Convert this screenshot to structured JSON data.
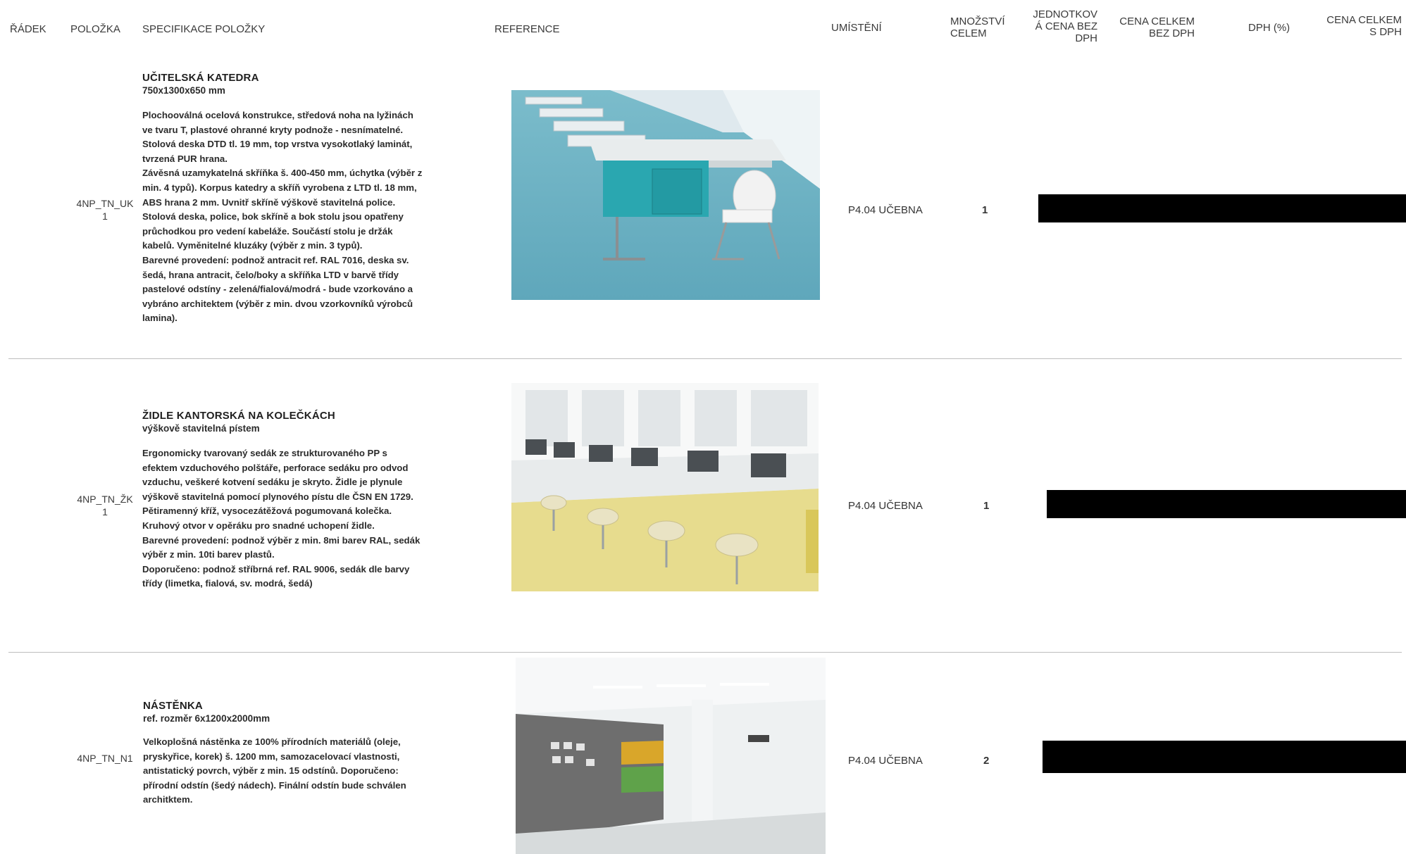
{
  "headers": {
    "radek": "ŘÁDEK",
    "polozka": "POLOŽKA",
    "specifikace": "SPECIFIKACE POLOŽKY",
    "reference": "REFERENCE",
    "umisteni": "UMÍSTĚNÍ",
    "mnozstvi_line1": "MNOŽSTVÍ",
    "mnozstvi_line2": "CELEM",
    "jednotkova_line1": "JEDNOTKOV",
    "jednotkova_line2": "Á CENA BEZ",
    "jednotkova_line3": "DPH",
    "cena_bez_line1": "CENA CELKEM",
    "cena_bez_line2": "BEZ DPH",
    "dph": "DPH (%)",
    "cena_s_line1": "CENA CELKEM",
    "cena_s_line2": "S DPH"
  },
  "rows": [
    {
      "code_line1": "4NP_TN_UK",
      "code_line2": "1",
      "title": "UČITELSKÁ KATEDRA",
      "subtitle": "750x1300x650 mm",
      "description": "Plochooválná ocelová konstrukce, středová noha na lyžinách\nve tvaru T, plastové ohranné kryty podnože - nesnímatelné.\nStolová deska DTD tl. 19 mm, top vrstva vysokotlaký laminát,\ntvrzená PUR hrana.\nZávěsná uzamykatelná skříňka š. 400-450 mm, úchytka (výběr z\nmin. 4 typů). Korpus katedry a skříň vyrobena z LTD tl. 18 mm,\nABS hrana 2 mm. Uvnitř skříně výškově stavitelná police.\nStolová deska, police, bok skříně a bok stolu jsou opatřeny\nprůchodkou pro vedení kabeláže. Součástí stolu je držák\nkabelů. Vyměnitelné kluzáky (výběr z min. 3 typů).\nBarevné provedení: podnož antracit ref. RAL 7016, deska sv.\nšedá, hrana antracit, čelo/boky a skříňka LTD v barvě třídy\npastelové odstíny - zelená/fialová/modrá - bude vzorkováno a\nvybráno architektem (výběr z min. dvou vzorkovníků výrobců\nlamina).",
      "location": "P4.04 UČEBNA",
      "quantity": "1"
    },
    {
      "code_line1": "4NP_TN_ŽK",
      "code_line2": "1",
      "title": "ŽIDLE KANTORSKÁ NA KOLEČKÁCH",
      "subtitle": "výškově stavitelná pístem",
      "description": "Ergonomicky tvarovaný sedák ze strukturovaného PP s\nefektem vzduchového polštáře, perforace sedáku pro odvod\nvzduchu, veškeré kotvení sedáku je skryto. Židle je plynule\nvýškově stavitelná pomocí plynového pístu dle ČSN EN 1729.\nPětiramenný kříž, vysocezátěžová pogumovaná kolečka.\nKruhový otvor v opěráku pro snadné uchopení židle.\nBarevné provedení: podnož výběr z min. 8mi barev RAL, sedák\nvýběr z min. 10ti barev plastů.\nDoporučeno: podnož stříbrná ref. RAL 9006, sedák dle barvy\ntřídy (limetka, fialová, sv. modrá, šedá)",
      "location": "P4.04 UČEBNA",
      "quantity": "1"
    },
    {
      "code_line1": "4NP_TN_N1",
      "code_line2": "",
      "title": "NÁSTĚNKA",
      "subtitle": "ref. rozměr 6x1200x2000mm",
      "description": "Velkoplošná nástěnka ze 100% přírodních materiálů (oleje,\npryskyřice, korek) š. 1200 mm, samozacelovací vlastnosti,\nantistatický povrch, výběr z min. 15 odstínů. Doporučeno:\npřírodní odstín (šedý nádech). Finální odstín bude schválen\narchitktem.",
      "location": "P4.04 UČEBNA",
      "quantity": "2"
    }
  ],
  "images": [
    {
      "icon": "teacher-desk-photo",
      "accent": "#2aa7b0",
      "floor": "#6fb3c4"
    },
    {
      "icon": "teacher-chair-photo",
      "accent": "#d9c75a",
      "floor": "#e7dc8e"
    },
    {
      "icon": "noticeboard-photo",
      "accent": "#d9a62a",
      "board": "#6e6e6e"
    }
  ],
  "colors": {
    "redaction": "#000000",
    "separator": "#bdbdbd"
  }
}
